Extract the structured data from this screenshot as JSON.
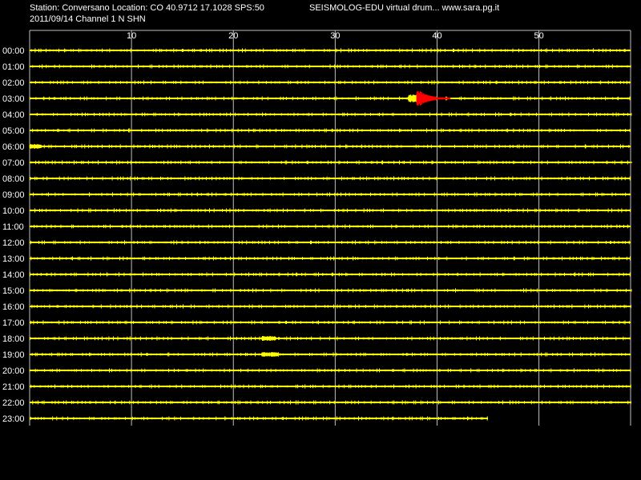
{
  "header": {
    "station_info": "Station: Conversano Location: CO 40.9712 17.1028 SPS:50",
    "app_title": "SEISMOLOG-EDU virtual drum... www.sara.pg.it",
    "date_channel": "2011/09/14  Channel 1 N SHN"
  },
  "colors": {
    "background": "#000000",
    "trace": "#ffff00",
    "event": "#ff0000",
    "grid": "#c0c0c0",
    "text": "#ffffff"
  },
  "chart_data": {
    "type": "line",
    "title": "",
    "xlabel": "",
    "ylabel": "",
    "xlim": [
      0,
      59
    ],
    "x_ticks": [
      10,
      20,
      30,
      40,
      50
    ],
    "hours": [
      "00:00",
      "01:00",
      "02:00",
      "03:00",
      "04:00",
      "05:00",
      "06:00",
      "07:00",
      "08:00",
      "09:00",
      "10:00",
      "11:00",
      "12:00",
      "13:00",
      "14:00",
      "15:00",
      "16:00",
      "17:00",
      "18:00",
      "19:00",
      "20:00",
      "21:00",
      "22:00",
      "23:00"
    ],
    "last_trace_end_minute": 45,
    "events": [
      {
        "hour": "03:00",
        "start_minute": 37.2,
        "peak_start_minute": 38.0,
        "end_minute": 41.3
      }
    ],
    "noise_bursts": [
      {
        "hour": "06:00",
        "start_minute": 0,
        "end_minute": 1.2
      },
      {
        "hour": "18:00",
        "start_minute": 22.8,
        "end_minute": 24.2
      },
      {
        "hour": "19:00",
        "start_minute": 22.8,
        "end_minute": 24.5
      }
    ],
    "grid": true
  }
}
